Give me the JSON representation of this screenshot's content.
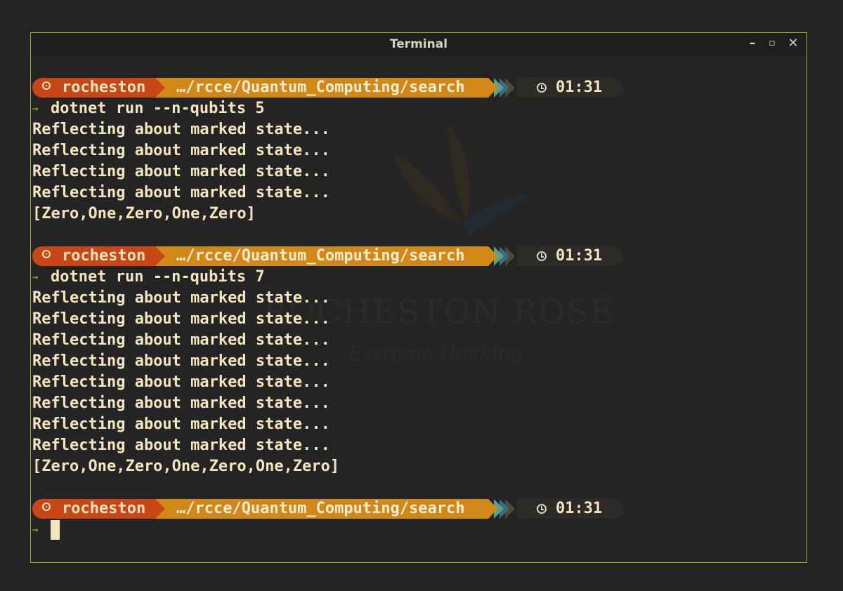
{
  "window": {
    "title": "Terminal",
    "controls": {
      "minimize": "–",
      "maximize": "▫",
      "close": "✕"
    }
  },
  "prompt": {
    "user": "rocheston",
    "path": "…/rcce/Quantum_Computing/search",
    "time": "01:31",
    "arrow": "→"
  },
  "colors": {
    "user_bg": "#c94716",
    "path_bg": "#d28819",
    "text": "#f3e5c0",
    "border": "#a3a82e"
  },
  "watermark": {
    "name": "ROCHESTON ROSÉ",
    "tagline": "Extreme Hacking"
  },
  "blocks": [
    {
      "command": "dotnet run --n-qubits 5",
      "output": [
        "Reflecting about marked state...",
        "Reflecting about marked state...",
        "Reflecting about marked state...",
        "Reflecting about marked state...",
        "[Zero,One,Zero,One,Zero]"
      ]
    },
    {
      "command": "dotnet run --n-qubits 7",
      "output": [
        "Reflecting about marked state...",
        "Reflecting about marked state...",
        "Reflecting about marked state...",
        "Reflecting about marked state...",
        "Reflecting about marked state...",
        "Reflecting about marked state...",
        "Reflecting about marked state...",
        "Reflecting about marked state...",
        "[Zero,One,Zero,One,Zero,One,Zero]"
      ]
    }
  ]
}
